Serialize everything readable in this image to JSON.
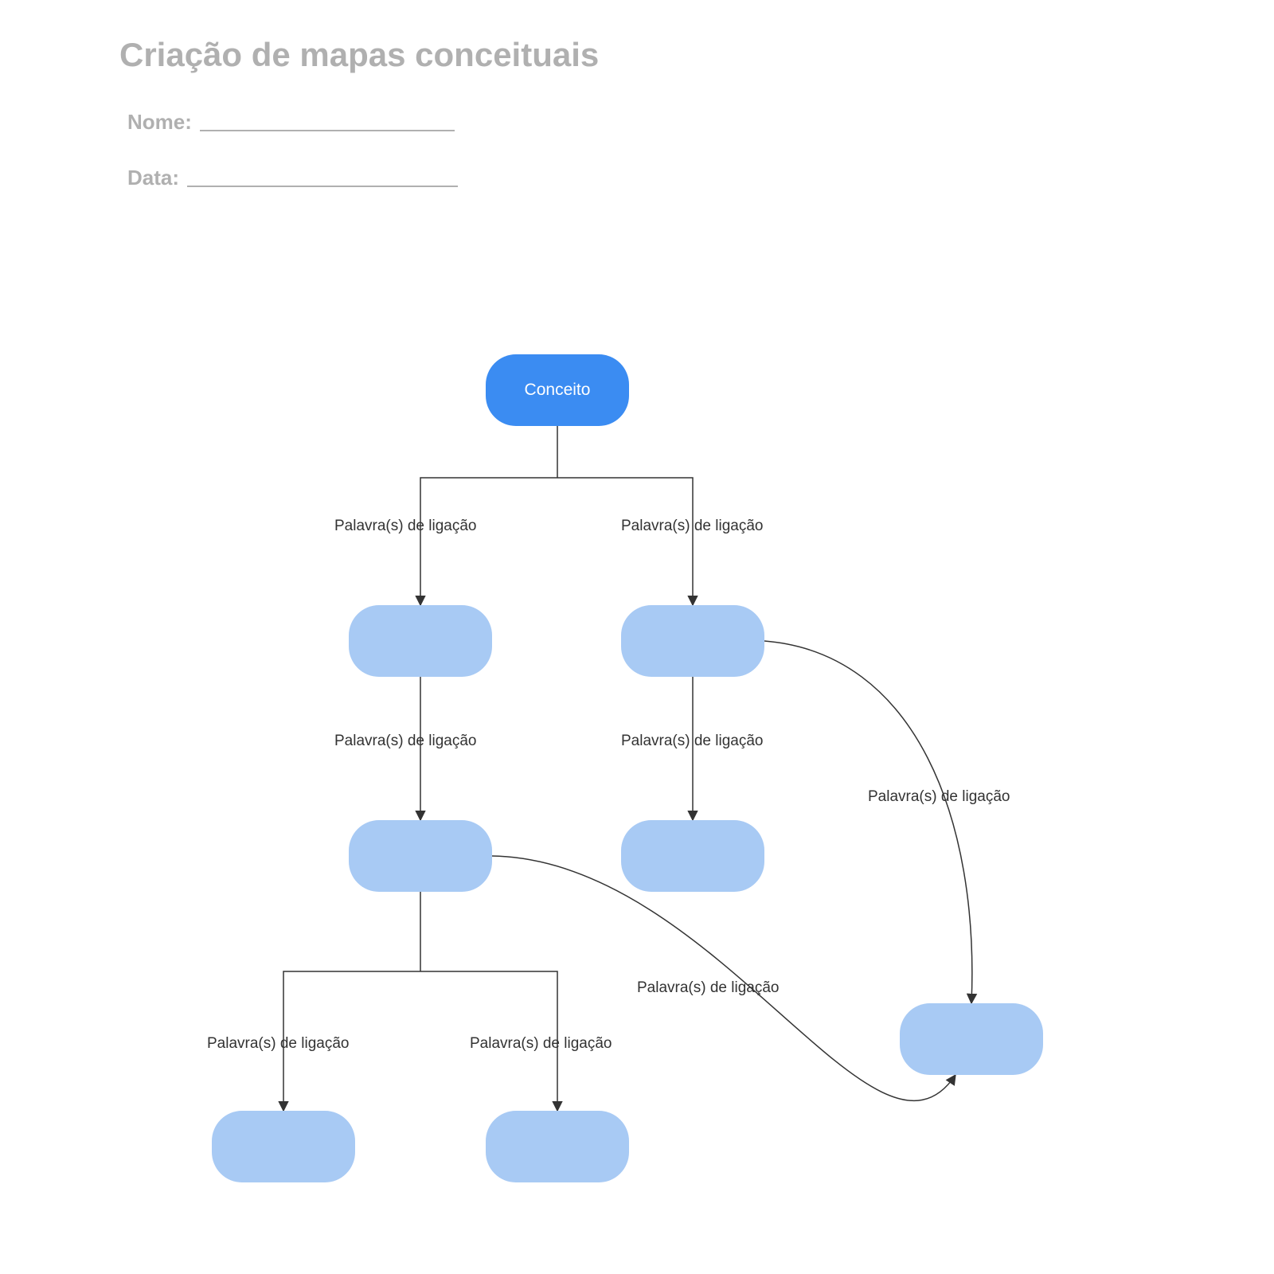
{
  "header": {
    "title": "Criação de mapas conceituais",
    "name_label": "Nome:",
    "date_label": "Data:"
  },
  "nodes": {
    "root": {
      "label": "Conceito"
    },
    "n2": {
      "label": ""
    },
    "n3": {
      "label": ""
    },
    "n4": {
      "label": ""
    },
    "n5": {
      "label": ""
    },
    "n6": {
      "label": ""
    },
    "n7": {
      "label": ""
    },
    "n8": {
      "label": ""
    }
  },
  "edges": {
    "e1": {
      "label": "Palavra(s) de ligação"
    },
    "e2": {
      "label": "Palavra(s) de ligação"
    },
    "e3": {
      "label": "Palavra(s) de ligação"
    },
    "e4": {
      "label": "Palavra(s) de ligação"
    },
    "e5": {
      "label": "Palavra(s) de ligação"
    },
    "e6": {
      "label": "Palavra(s) de ligação"
    },
    "e7": {
      "label": "Palavra(s) de ligação"
    },
    "e8": {
      "label": "Palavra(s) de ligação"
    }
  },
  "colors": {
    "root_fill": "#3b8cf2",
    "leaf_fill": "#a8caf4",
    "stroke": "#333333",
    "header_text": "#b0b0b0"
  }
}
